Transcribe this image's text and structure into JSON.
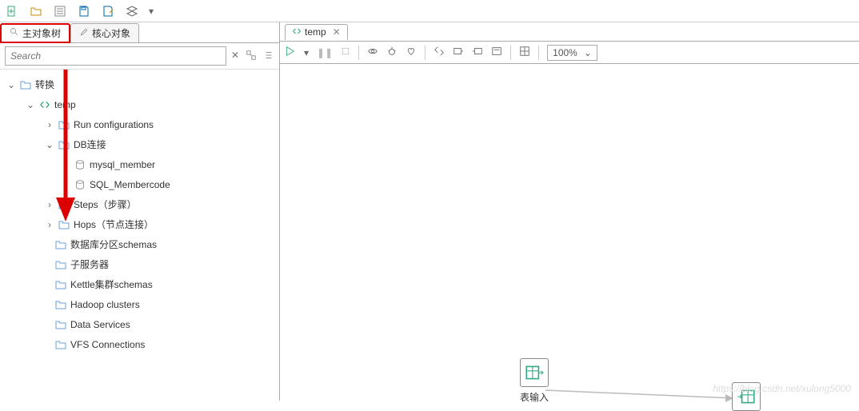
{
  "tabs": {
    "main_tree": "主对象树",
    "core": "核心对象"
  },
  "search": {
    "placeholder": "Search"
  },
  "tree": {
    "root": "转换",
    "temp": "temp",
    "run_config": "Run configurations",
    "db_conn": "DB连接",
    "db1": "mysql_member",
    "db2": "SQL_Membercode",
    "steps": "Steps（步骤）",
    "hops": "Hops（节点连接）",
    "schemas": "数据库分区schemas",
    "subserver": "子服务器",
    "kettle": "Kettle集群schemas",
    "hadoop": "Hadoop clusters",
    "data_services": "Data Services",
    "vfs": "VFS Connections"
  },
  "editor": {
    "tab": "temp",
    "zoom": "100%"
  },
  "canvas": {
    "node1": "表输入",
    "watermark": "https://blog.csdn.net/xulong5000"
  }
}
